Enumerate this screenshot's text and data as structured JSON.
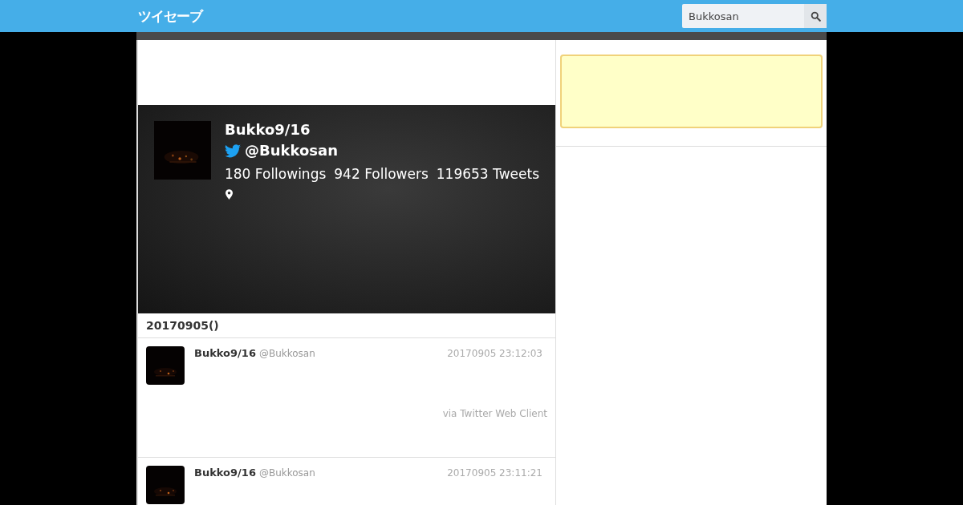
{
  "header": {
    "logo": "ツイセーブ",
    "search": {
      "value": "Bukkosan"
    }
  },
  "profile": {
    "name": "Bukko9/16",
    "handle": "@Bukkosan",
    "followings": "180 Followings",
    "followers": "942 Followers",
    "tweets": "119653 Tweets"
  },
  "date_heading": "20170905()",
  "tweets": [
    {
      "name": "Bukko9/16",
      "handle": "@Bukkosan",
      "time": "20170905 23:12:03",
      "via": "via Twitter Web Client"
    },
    {
      "name": "Bukko9/16",
      "handle": "@Bukkosan",
      "time": "20170905 23:11:21"
    }
  ]
}
